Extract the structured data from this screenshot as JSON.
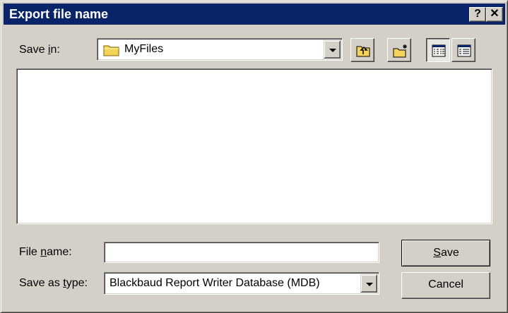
{
  "window": {
    "title": "Export file name",
    "help_button": "?",
    "close_button": "✕"
  },
  "save_in": {
    "label_pre": "Save ",
    "label_accel": "i",
    "label_post": "n:",
    "value": "MyFiles"
  },
  "toolbar": {
    "up_one_level_icon": "folder-up-icon",
    "new_folder_icon": "new-folder-icon",
    "list_view_icon": "list-view-icon",
    "details_view_icon": "details-view-icon"
  },
  "file_list": {
    "items": []
  },
  "file_name": {
    "label_pre": "File ",
    "label_accel": "n",
    "label_post": "ame:",
    "value": ""
  },
  "save_as_type": {
    "label_pre": "Save as ",
    "label_accel": "t",
    "label_post": "ype:",
    "value": "Blackbaud Report Writer Database (MDB)"
  },
  "buttons": {
    "save_accel": "S",
    "save_rest": "ave",
    "cancel": "Cancel"
  },
  "colors": {
    "titlebar": "#0a246a",
    "face": "#d4d0c8",
    "folder": "#f4d35a"
  }
}
